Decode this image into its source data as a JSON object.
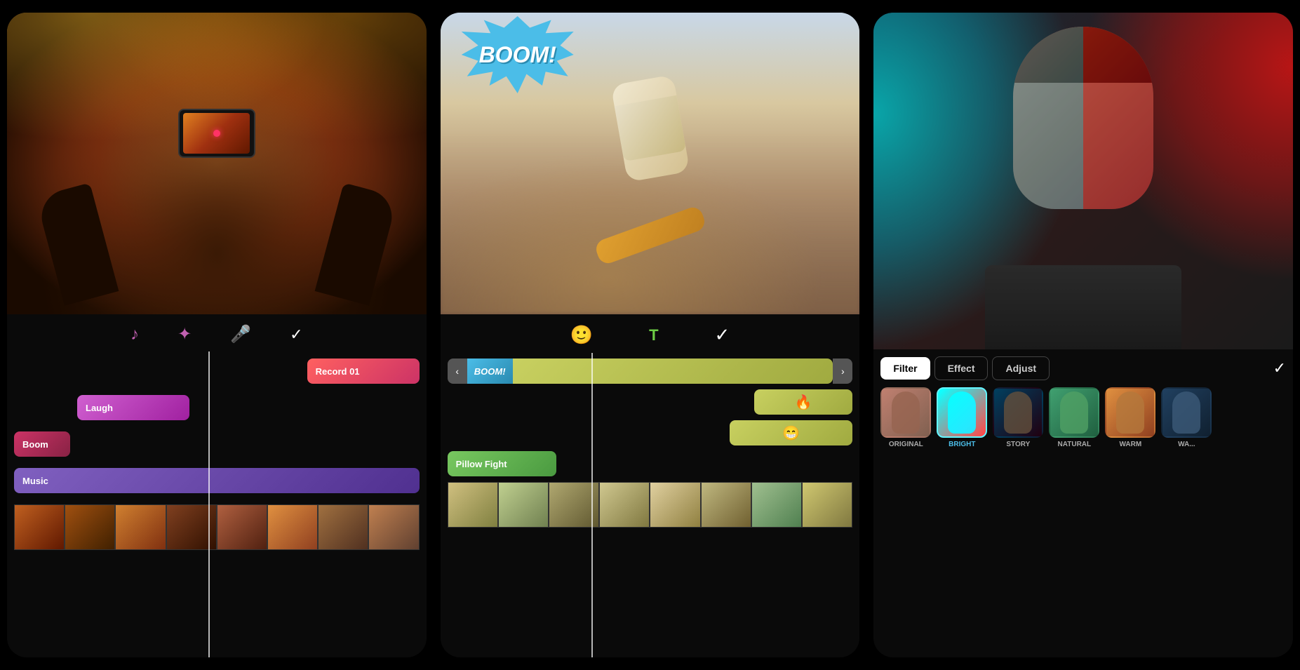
{
  "screen1": {
    "toolbar": {
      "music_icon": "♪",
      "fx_icon": "✦",
      "mic_icon": "🎤",
      "check_icon": "✓"
    },
    "tracks": {
      "record01": "Record 01",
      "laugh": "Laugh",
      "boom": "Boom",
      "music": "Music"
    },
    "filmstrip_count": 8
  },
  "screen2": {
    "boom_sticker_text": "BOOM!",
    "toolbar": {
      "emoji_icon": "🙂",
      "text_icon": "T",
      "check_icon": "✓"
    },
    "tracks": {
      "boom_label": "BOOM!",
      "fire_emoji": "🔥",
      "smile_emoji": "😁",
      "pillow_fight": "Pillow Fight"
    },
    "filmstrip_count": 8
  },
  "screen3": {
    "tabs": {
      "filter": "Filter",
      "effect": "Effect",
      "adjust": "Adjust"
    },
    "active_tab": "Filter",
    "check_icon": "✓",
    "filters": [
      {
        "id": "original",
        "label": "ORIGINAL",
        "selected": false
      },
      {
        "id": "bright",
        "label": "BRIGHT",
        "selected": true
      },
      {
        "id": "story",
        "label": "STORY",
        "selected": false
      },
      {
        "id": "natural",
        "label": "NATURAL",
        "selected": false
      },
      {
        "id": "warm",
        "label": "WARM",
        "selected": false
      },
      {
        "id": "extra",
        "label": "WA...",
        "selected": false
      }
    ]
  }
}
